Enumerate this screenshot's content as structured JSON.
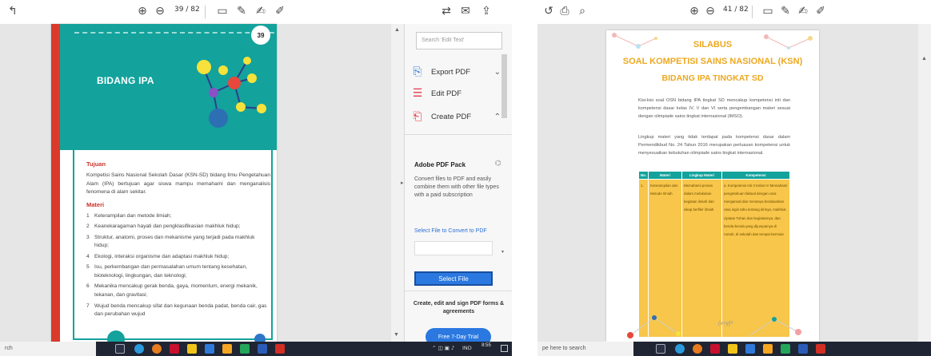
{
  "left_window": {
    "toolbar": {
      "page_current": "39",
      "page_total": "/ 82"
    },
    "document": {
      "page_number": "39",
      "banner_title": "BIDANG IPA",
      "section_tujuan_heading": "Tujuan",
      "tujuan_text": "Kompetisi Sains Nasional Sekolah Dasar (KSN-SD) bidang Ilmu Pengetahuan Alam (IPA) bertujuan agar siswa mampu memahami dan menganalisis fenomena di alam sekitar.",
      "section_materi_heading": "Materi",
      "materi_items": [
        {
          "n": "1",
          "text": "Keterampilan dan metode ilmiah;"
        },
        {
          "n": "2",
          "text": "Keanekaragaman hayati dan pengklasifikasian makhluk hidup;"
        },
        {
          "n": "3",
          "text": "Struktur, anatomi, proses dan mekanisme yang terjadi pada makhluk hidup;"
        },
        {
          "n": "4",
          "text": "Ekologi, interaksi organisme dan adaptasi makhluk hidup;"
        },
        {
          "n": "5",
          "text": "Isu, perkembangan dan permasalahan umum tentang kesehatan, bioteknologi, lingkungan, dan teknologi;"
        },
        {
          "n": "6",
          "text": "Mekanika mencakup gerak benda, gaya, momentum, energi mekanik, tekanan, dan gravitasi;"
        },
        {
          "n": "7",
          "text": "Wujud benda mencakup sifat dan kegunaan benda padat, benda cair, gas dan perubahan wujud"
        }
      ]
    },
    "tools_pane": {
      "search_placeholder": "Search 'Edit Text'",
      "export_pdf": "Export PDF",
      "edit_pdf": "Edit PDF",
      "create_pdf": "Create PDF",
      "pack_title": "Adobe PDF Pack",
      "pack_desc": "Convert files to PDF and easily combine them with other file types with a paid subscription",
      "select_link": "Select File to Convert to PDF",
      "select_button": "Select File",
      "create_text": "Create, edit and sign PDF forms & agreements",
      "trial_button": "Free 7-Day Trial"
    },
    "taskbar": {
      "search_text": "rch",
      "tray_lang": "IND",
      "clock_time": "8:55"
    }
  },
  "right_window": {
    "toolbar": {
      "page_current": "41",
      "page_total": "/ 82"
    },
    "document": {
      "title_1": "SILABUS",
      "title_2": "SOAL KOMPETISI SAINS NASIONAL (KSN)",
      "title_3": "BIDANG IPA TINGKAT SD",
      "para_1": "Kisi-kisi soal OSN bidang IPA tingkat SD mencakup kompetensi inti dan kompetensi dasar kelas IV, V dan VI serta pengembangan materi sesuai dengan olimpiade sains tingkat internasional (IMSO).",
      "para_2": "Lingkup materi yang tidak terdapat pada kompetensi dasar dalam Permendikbud No. 24 Tahun 2016 merupakan perluasan kompetensi untuk menyesuaikan kebutuhan olimpiade sains tingkat internasional.",
      "table_headers": [
        "No.",
        "Materi",
        "Lingkup Materi",
        "Kompetensi"
      ],
      "table_row": {
        "no": "1.",
        "materi": "Keterampilan dan Metode Ilmiah",
        "lingkup": "Memahami proses dalam melakukan kegiatan ilmiah dan sikap berfikir ilmiah",
        "kompetensi_num": "a.",
        "kompetensi": "Kompetensi Inti 3 Kelas IV Memahami pengetahuan faktual dengan cara mengamati dan menanya berdasarkan rasa ingin tahu tentang dirinya, makhluk ciptaan Tuhan dan kegiatannya, dan benda-benda yang dijumpainya di rumah, di sekolah dan tempat bermain"
      },
      "deco_formula": "(x+y)²"
    },
    "taskbar": {
      "search_text": "pe here to search"
    }
  }
}
